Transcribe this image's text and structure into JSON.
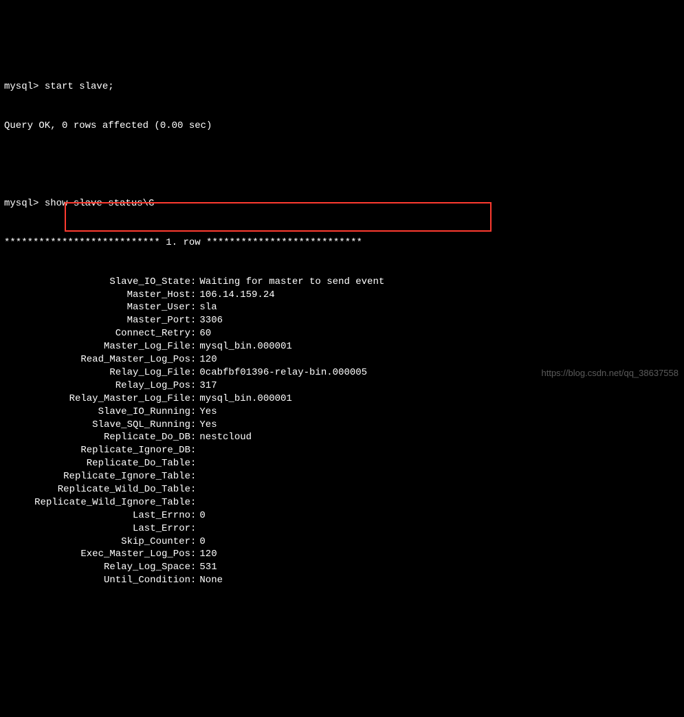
{
  "prompt1": "mysql> ",
  "cmd1": "start slave;",
  "result1": "Query OK, 0 rows affected (0.00 sec)",
  "prompt2": "mysql> ",
  "cmd2": "show slave status\\G",
  "row_header": "*************************** 1. row ***************************",
  "rows": [
    {
      "label": "Slave_IO_State",
      "value": "Waiting for master to send event"
    },
    {
      "label": "Master_Host",
      "value": "106.14.159.24"
    },
    {
      "label": "Master_User",
      "value": "sla"
    },
    {
      "label": "Master_Port",
      "value": "3306"
    },
    {
      "label": "Connect_Retry",
      "value": "60"
    },
    {
      "label": "Master_Log_File",
      "value": "mysql_bin.000001"
    },
    {
      "label": "Read_Master_Log_Pos",
      "value": "120"
    },
    {
      "label": "Relay_Log_File",
      "value": "0cabfbf01396-relay-bin.000005"
    },
    {
      "label": "Relay_Log_Pos",
      "value": "317"
    },
    {
      "label": "Relay_Master_Log_File",
      "value": "mysql_bin.000001"
    },
    {
      "label": "Slave_IO_Running",
      "value": "Yes"
    },
    {
      "label": "Slave_SQL_Running",
      "value": "Yes"
    },
    {
      "label": "Replicate_Do_DB",
      "value": "nestcloud"
    },
    {
      "label": "Replicate_Ignore_DB",
      "value": ""
    },
    {
      "label": "Replicate_Do_Table",
      "value": ""
    },
    {
      "label": "Replicate_Ignore_Table",
      "value": ""
    },
    {
      "label": "Replicate_Wild_Do_Table",
      "value": ""
    },
    {
      "label": "Replicate_Wild_Ignore_Table",
      "value": ""
    },
    {
      "label": "Last_Errno",
      "value": "0"
    },
    {
      "label": "Last_Error",
      "value": ""
    },
    {
      "label": "Skip_Counter",
      "value": "0"
    },
    {
      "label": "Exec_Master_Log_Pos",
      "value": "120"
    },
    {
      "label": "Relay_Log_Space",
      "value": "531"
    },
    {
      "label": "Until_Condition",
      "value": "None"
    }
  ],
  "watermark": "https://blog.csdn.net/qq_38637558"
}
